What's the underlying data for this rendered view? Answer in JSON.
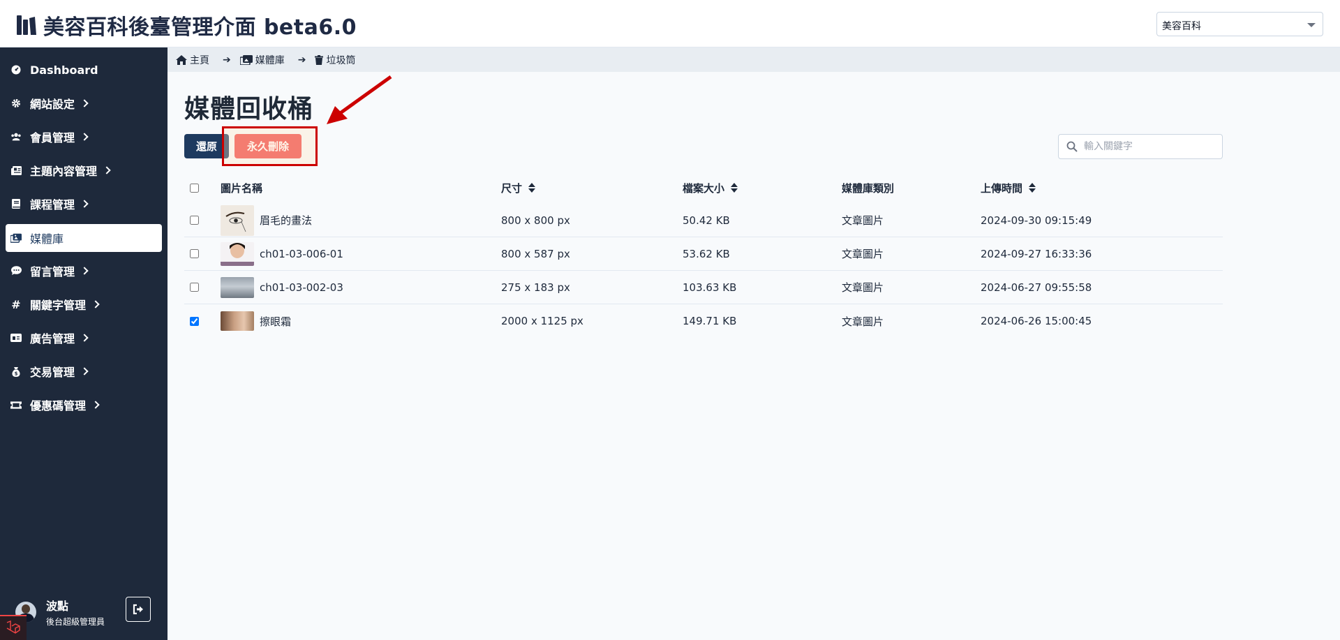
{
  "app": {
    "title": "美容百科後臺管理介面 beta6.0",
    "site_selector": "美容百科"
  },
  "sidebar": {
    "items": [
      {
        "label": "Dashboard",
        "icon": "dashboard-icon",
        "has_children": false,
        "active": false
      },
      {
        "label": "網站設定",
        "icon": "gear-icon",
        "has_children": true,
        "active": false
      },
      {
        "label": "會員管理",
        "icon": "users-icon",
        "has_children": true,
        "active": false
      },
      {
        "label": "主題內容管理",
        "icon": "newspaper-icon",
        "has_children": true,
        "active": false
      },
      {
        "label": "課程管理",
        "icon": "book-icon",
        "has_children": true,
        "active": false
      },
      {
        "label": "媒體庫",
        "icon": "images-icon",
        "has_children": false,
        "active": true
      },
      {
        "label": "留言管理",
        "icon": "comment-icon",
        "has_children": true,
        "active": false
      },
      {
        "label": "關鍵字管理",
        "icon": "hashtag-icon",
        "has_children": true,
        "active": false
      },
      {
        "label": "廣告管理",
        "icon": "ad-icon",
        "has_children": true,
        "active": false
      },
      {
        "label": "交易管理",
        "icon": "money-bag-icon",
        "has_children": true,
        "active": false
      },
      {
        "label": "優惠碼管理",
        "icon": "ticket-icon",
        "has_children": true,
        "active": false
      }
    ],
    "user": {
      "name": "波點",
      "role": "後台超級管理員"
    }
  },
  "breadcrumb": [
    {
      "label": "主頁",
      "icon": "home-icon"
    },
    {
      "label": "媒體庫",
      "icon": "images-icon"
    },
    {
      "label": "垃圾筒",
      "icon": "trash-icon"
    }
  ],
  "page": {
    "title": "媒體回收桶",
    "restore_label": "還原",
    "delete_label": "永久刪除",
    "search_placeholder": "輸入關鍵字"
  },
  "table": {
    "columns": [
      "圖片名稱",
      "尺寸",
      "檔案大小",
      "媒體庫類別",
      "上傳時間"
    ],
    "sortable": [
      false,
      true,
      true,
      false,
      true
    ],
    "rows": [
      {
        "name": "眉毛的畫法",
        "size": "800 x 800 px",
        "filesize": "50.42 KB",
        "category": "文章圖片",
        "uploaded": "2024-09-30 09:15:49",
        "checked": false,
        "thumb": "eyebrow-sketch"
      },
      {
        "name": "ch01-03-006-01",
        "size": "800 x 587 px",
        "filesize": "53.62 KB",
        "category": "文章圖片",
        "uploaded": "2024-09-27 16:33:36",
        "checked": false,
        "thumb": "portrait"
      },
      {
        "name": "ch01-03-002-03",
        "size": "275 x 183 px",
        "filesize": "103.63 KB",
        "category": "文章圖片",
        "uploaded": "2024-06-27 09:55:58",
        "checked": false,
        "thumb": "grey-texture"
      },
      {
        "name": "擦眼霜",
        "size": "2000 x 1125 px",
        "filesize": "149.71 KB",
        "category": "文章圖片",
        "uploaded": "2024-06-26 15:00:45",
        "checked": true,
        "thumb": "face-closeup"
      }
    ]
  },
  "colors": {
    "sidebar_bg": "#1e293b",
    "primary": "#1e3a5f",
    "danger": "#ef4444",
    "annotation": "#cc0000"
  }
}
